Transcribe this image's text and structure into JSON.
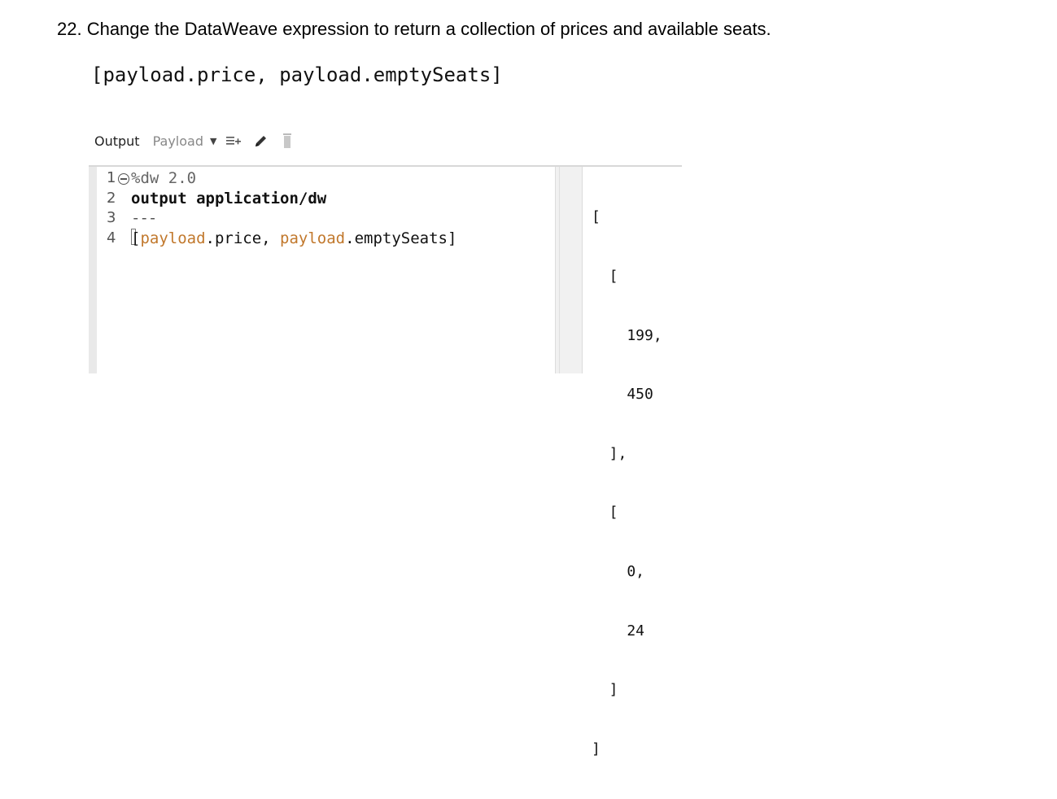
{
  "instruction": {
    "heading": "22. Change the DataWeave expression to return a collection of prices and available seats.",
    "code": "[payload.price, payload.emptySeats]"
  },
  "toolbar": {
    "output_label": "Output",
    "target_select": "Payload",
    "icons": [
      "caret-down-icon",
      "add-lines-icon",
      "pencil-icon",
      "trash-icon"
    ]
  },
  "editor": {
    "lines": [
      {
        "number": "1",
        "text": "%dw 2.0"
      },
      {
        "number": "2",
        "kw": "output",
        "rest": " application/dw"
      },
      {
        "number": "3",
        "text": "---"
      },
      {
        "number": "4",
        "var1": "payload",
        "text1": ".price, ",
        "var2": "payload",
        "text2": ".emptySeats]",
        "open": "["
      }
    ]
  },
  "output": {
    "lines": [
      "[",
      "  [",
      "    199,",
      "    450",
      "  ],",
      "  [",
      "    0,",
      "    24",
      "  ]",
      "]"
    ]
  },
  "colors": {
    "variable": "#c1782c",
    "comment": "#666666"
  }
}
